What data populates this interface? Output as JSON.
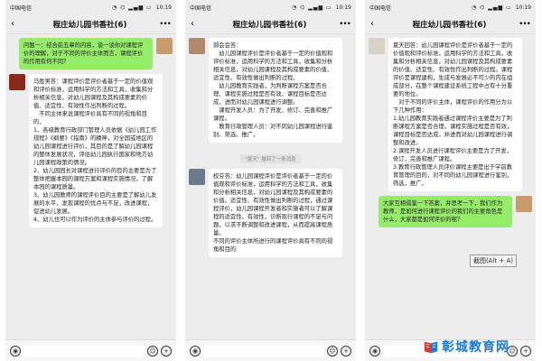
{
  "status": {
    "carrier": "中国电信",
    "icons": "◔ ⌬ ▂▄▆ ▭",
    "time": "10:19"
  },
  "chat_title": "程庄幼儿园书香社(6)",
  "panels": [
    {
      "messages": [
        {
          "type": "msg",
          "side": "right",
          "avatar": "#c89b6a",
          "text": "问题一：结合前五章的内容，谈一谈你对课程评价的理解，对于不同的评价主体而言，课程评价的作用有何不同？"
        },
        {
          "type": "msg",
          "side": "left",
          "avatar": "#8a2a1c",
          "text": "马胜男答：课程评价是评价者基于一定的价值观和评价标准，运用科学的方法和工具，收集和分析相关信息，对幼儿园课程及其构成要素的价值、适宜性、有效性作出判断的过程。\n　不同主体来说课程评价具有不同的视角和目的，\n1、各级教育行政部门管理人员依据《幼儿园工作规程》《纲要》《指南》的精神，对全国或地区的幼儿园课程进行评价，其目的是了解幼儿园课程的整体发展状况，评估幼儿园执行国家和地方幼儿园课程政策的情况。\n2、幼儿园园长对课程进行评价的目的主要是为了整体把握本园的课程方案和课程实施情况，了解本园的课程质量。\n3、幼儿园教师的课程评价目的主要是了解幼儿发展的水平，发现课程的优点与不足，改进课程，促进幼儿发展。\n4、幼儿也可以作为评价的主体参与评价的过程。"
        }
      ]
    },
    {
      "messages": [
        {
          "type": "msg",
          "side": "left",
          "avatar": "#b08a6a",
          "text": "郝会会答：\n　幼儿园课程评价是评价者基于一定的价值观和评价标准，运用科学的方法和工具，收集和分析相关信息，对幼儿园课程及其构成要素的价值、适宜性、有效性做出判断的过程。\n　幼儿园教育实践者，为判断课程方案是否合理、课程实施过程是否有效、课程目标是否达成，进而对幼儿园课程进行调整。\n　课程开发人员：为了开发、修订、完善和推广课程。\n　教育行政管理人员：对不同幼儿园课程进行鉴别、筛选、推广。"
        },
        {
          "type": "system",
          "text": "\"夏天\" 撤回了一条消息"
        },
        {
          "type": "msg",
          "side": "left",
          "avatar": "#6a7a8a",
          "text": "权芬答：幼儿园课程评价是评价者基于一定的价值观和评价标准，运用科学的方法和工具，收集和分析相关信息，对幼儿园课程及其构成要素的价值、适宜性、有效性做出判断的过程，通过课程评价，幼儿园课程开发者和实施者可以了解课程的适宜性、有效性，诊断现行课程的不足与问题，以求不断调整和改进课程，从而提高课程质量。\n不同的评价主体所进行的课程评价具有不同的视角和目的"
        }
      ]
    },
    {
      "messages": [
        {
          "type": "msg",
          "side": "left",
          "avatar": "#d7d2c8",
          "text": "夏天回答：幼儿园课程评价是评价者基于一定的价值观和评价标准，运用科学的方法和工具，收集和分析相关信息，对幼儿园课程及其构成要素的价值、适宜性、有效性作出判断的过程。课程评价是课程建构，生成与发展必不可少的内在组成部分，在整个课程建设系统工程中占有十分重要的地位。\n　对于不同的评价主体，课程评价的作用分为以下几种作用：\n1.幼儿园教育实践者通过课程评价主要是为了判断课程方案是否合理，课程实施过程是否有效，课程目标是否达成，并进而对幼儿园课程进行调整和改进。\n2.课程开发人员进行课程评价主要是为了开发，修订，完善和推广课程。\n3.教育行政管理人员评价课程主要是出于学前教育管理的目的，对不同的幼儿园课程进行鉴别，筛选，推广。"
        },
        {
          "type": "msg",
          "side": "right",
          "avatar": "#c89b6a",
          "text": "大家互相借鉴一下答案，并思考一下，我们作为教师，是如何进行课程评价的我们的主要角色是什么，大家都是如何评价的呢？"
        }
      ]
    }
  ],
  "tooltip": "截图(Alt + A)",
  "watermark": {
    "text": "彰城教育网"
  }
}
